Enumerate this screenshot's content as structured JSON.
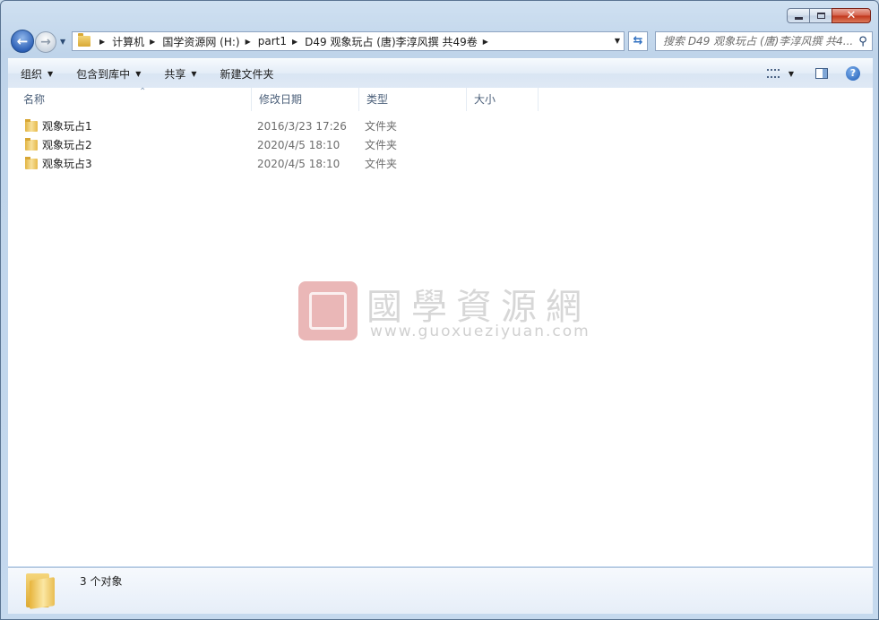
{
  "window": {
    "caption_buttons": {
      "minimize": "minimize",
      "maximize": "maximize",
      "close": "✕"
    }
  },
  "nav": {
    "back_icon": "back-arrow-icon",
    "forward_icon": "forward-arrow-icon",
    "breadcrumbs": [
      "计算机",
      "国学资源网 (H:)",
      "part1",
      "D49 观象玩占 (唐)李淳风撰 共49卷"
    ],
    "refresh_icon": "refresh-icon",
    "search_placeholder": "搜索 D49 观象玩占 (唐)李淳风撰 共4..."
  },
  "toolbar": {
    "organize": "组织",
    "include_in_library": "包含到库中",
    "share": "共享",
    "new_folder": "新建文件夹"
  },
  "columns": {
    "name": "名称",
    "modified": "修改日期",
    "type": "类型",
    "size": "大小"
  },
  "files": [
    {
      "name": "观象玩占1",
      "modified": "2016/3/23 17:26",
      "type": "文件夹",
      "size": ""
    },
    {
      "name": "观象玩占2",
      "modified": "2020/4/5 18:10",
      "type": "文件夹",
      "size": ""
    },
    {
      "name": "观象玩占3",
      "modified": "2020/4/5 18:10",
      "type": "文件夹",
      "size": ""
    }
  ],
  "watermark": {
    "title": "國學資源網",
    "url": "www.guoxueziyuan.com"
  },
  "status": {
    "count_text": "3 个对象"
  },
  "colors": {
    "accent": "#2f62b8",
    "window_frame": "#c9dced"
  }
}
